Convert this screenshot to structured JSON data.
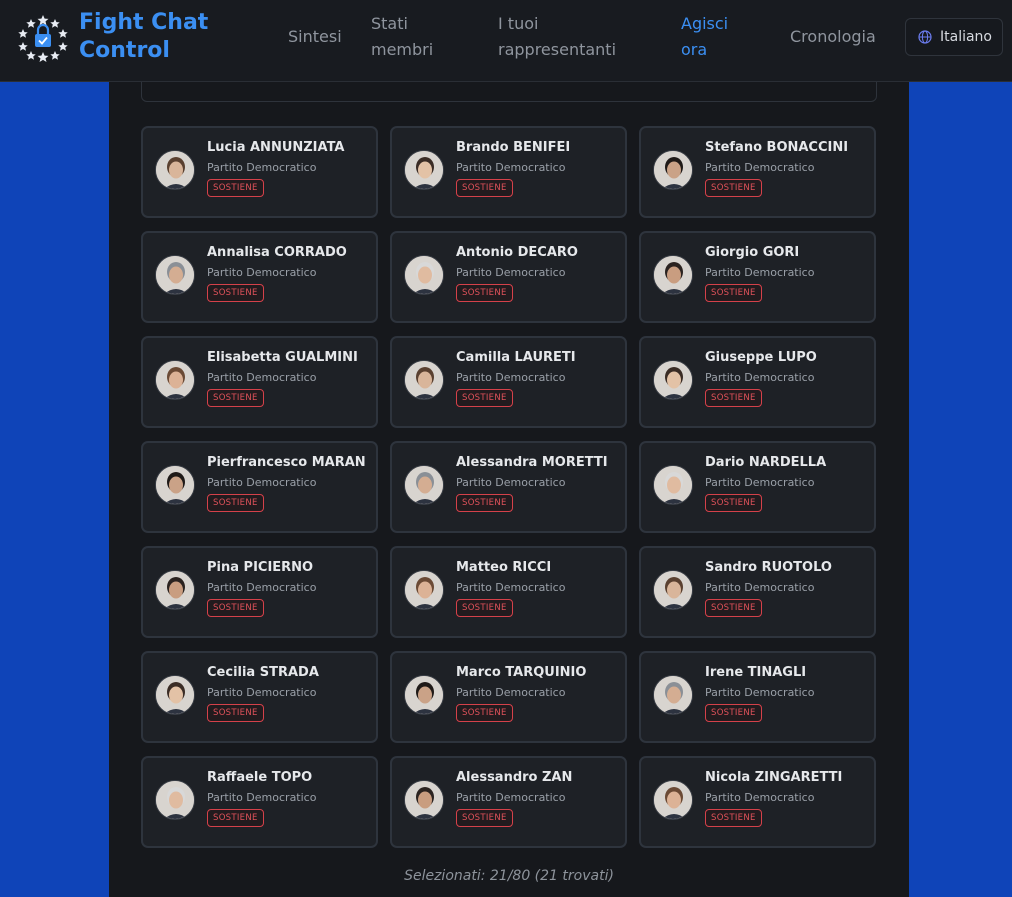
{
  "brand": "Fight Chat Control",
  "nav": [
    {
      "label": "Sintesi",
      "active": false
    },
    {
      "label": "Stati membri",
      "active": false
    },
    {
      "label": "I tuoi rappresentanti",
      "active": false
    },
    {
      "label": "Agisci ora",
      "active": true
    },
    {
      "label": "Cronologia",
      "active": false
    }
  ],
  "language": {
    "label": "Italiano",
    "icon": "globe-icon"
  },
  "colors": {
    "accent": "#3b8ff2",
    "page_bg": "#0f44b8",
    "badge": "#e0525a"
  },
  "cards": [
    {
      "name": "Lucia ANNUNZIATA",
      "party": "Partito Democratico",
      "status": "SOSTIENE"
    },
    {
      "name": "Brando BENIFEI",
      "party": "Partito Democratico",
      "status": "SOSTIENE"
    },
    {
      "name": "Stefano BONACCINI",
      "party": "Partito Democratico",
      "status": "SOSTIENE"
    },
    {
      "name": "Annalisa CORRADO",
      "party": "Partito Democratico",
      "status": "SOSTIENE"
    },
    {
      "name": "Antonio DECARO",
      "party": "Partito Democratico",
      "status": "SOSTIENE"
    },
    {
      "name": "Giorgio GORI",
      "party": "Partito Democratico",
      "status": "SOSTIENE"
    },
    {
      "name": "Elisabetta GUALMINI",
      "party": "Partito Democratico",
      "status": "SOSTIENE"
    },
    {
      "name": "Camilla LAURETI",
      "party": "Partito Democratico",
      "status": "SOSTIENE"
    },
    {
      "name": "Giuseppe LUPO",
      "party": "Partito Democratico",
      "status": "SOSTIENE"
    },
    {
      "name": "Pierfrancesco MARAN",
      "party": "Partito Democratico",
      "status": "SOSTIENE"
    },
    {
      "name": "Alessandra MORETTI",
      "party": "Partito Democratico",
      "status": "SOSTIENE"
    },
    {
      "name": "Dario NARDELLA",
      "party": "Partito Democratico",
      "status": "SOSTIENE"
    },
    {
      "name": "Pina PICIERNO",
      "party": "Partito Democratico",
      "status": "SOSTIENE"
    },
    {
      "name": "Matteo RICCI",
      "party": "Partito Democratico",
      "status": "SOSTIENE"
    },
    {
      "name": "Sandro RUOTOLO",
      "party": "Partito Democratico",
      "status": "SOSTIENE"
    },
    {
      "name": "Cecilia STRADA",
      "party": "Partito Democratico",
      "status": "SOSTIENE"
    },
    {
      "name": "Marco TARQUINIO",
      "party": "Partito Democratico",
      "status": "SOSTIENE"
    },
    {
      "name": "Irene TINAGLI",
      "party": "Partito Democratico",
      "status": "SOSTIENE"
    },
    {
      "name": "Raffaele TOPO",
      "party": "Partito Democratico",
      "status": "SOSTIENE"
    },
    {
      "name": "Alessandro ZAN",
      "party": "Partito Democratico",
      "status": "SOSTIENE"
    },
    {
      "name": "Nicola ZINGARETTI",
      "party": "Partito Democratico",
      "status": "SOSTIENE"
    }
  ],
  "footer": {
    "count_text": "Selezionati: 21/80 (21 trovati)"
  }
}
